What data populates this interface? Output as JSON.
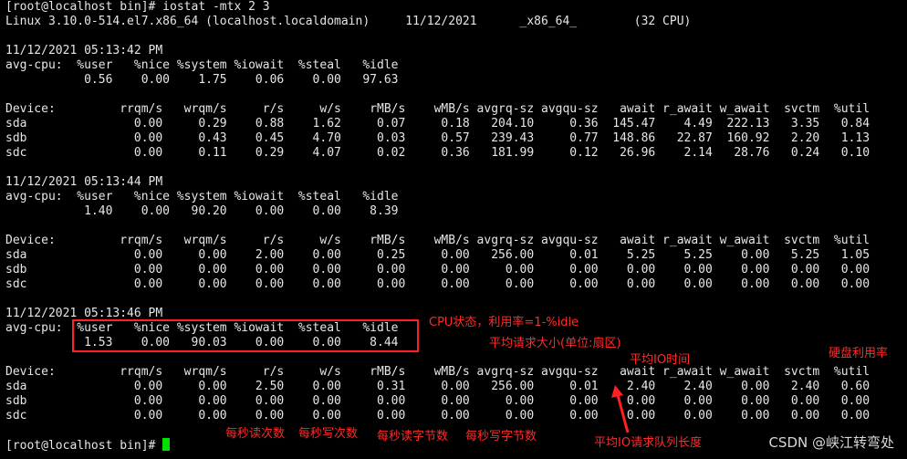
{
  "terminal": {
    "colors": {
      "background": "#000000",
      "text": "#e6e6e6",
      "cursor": "#00e000",
      "annotation": "#ff2a2a"
    },
    "lines": [
      "[root@localhost bin]# iostat -mtx 2 3",
      "Linux 3.10.0-514.el7.x86_64 (localhost.localdomain)     11/12/2021      _x86_64_        (32 CPU)",
      "",
      "11/12/2021 05:13:42 PM",
      "avg-cpu:  %user   %nice %system %iowait  %steal   %idle",
      "           0.56    0.00    1.75    0.06    0.00   97.63",
      "",
      "Device:         rrqm/s   wrqm/s     r/s     w/s    rMB/s    wMB/s avgrq-sz avgqu-sz   await r_await w_await  svctm  %util",
      "sda               0.00     0.29    0.88    1.62     0.07     0.18   204.10     0.36  145.47    4.49  222.13   3.35   0.84",
      "sdb               0.00     0.43    0.45    4.70     0.03     0.57   239.43     0.77  148.86   22.87  160.92   2.20   1.13",
      "sdc               0.00     0.11    0.29    4.07     0.02     0.36   181.99     0.12   26.96    2.14   28.76   0.24   0.10",
      "",
      "11/12/2021 05:13:44 PM",
      "avg-cpu:  %user   %nice %system %iowait  %steal   %idle",
      "           1.40    0.00   90.20    0.00    0.00    8.39",
      "",
      "Device:         rrqm/s   wrqm/s     r/s     w/s    rMB/s    wMB/s avgrq-sz avgqu-sz   await r_await w_await  svctm  %util",
      "sda               0.00     0.00    2.00    0.00     0.25     0.00   256.00     0.01    5.25    5.25    0.00   5.25   1.05",
      "sdb               0.00     0.00    0.00    0.00     0.00     0.00     0.00     0.00    0.00    0.00    0.00   0.00   0.00",
      "sdc               0.00     0.00    0.00    0.00     0.00     0.00     0.00     0.00    0.00    0.00    0.00   0.00   0.00",
      "",
      "11/12/2021 05:13:46 PM",
      "avg-cpu:  %user   %nice %system %iowait  %steal   %idle",
      "           1.53    0.00   90.03    0.00    0.00    8.44",
      "",
      "Device:         rrqm/s   wrqm/s     r/s     w/s    rMB/s    wMB/s avgrq-sz avgqu-sz   await r_await w_await  svctm  %util",
      "sda               0.00     0.00    2.50    0.00     0.31     0.00   256.00     0.01    2.40    2.40    0.00   2.40   0.60",
      "sdb               0.00     0.00    0.00    0.00     0.00     0.00     0.00     0.00    0.00    0.00    0.00   0.00   0.00",
      "sdc               0.00     0.00    0.00    0.00     0.00     0.00     0.00     0.00    0.00    0.00    0.00   0.00   0.00",
      "",
      "[root@localhost bin]# "
    ]
  },
  "annotations": {
    "cpu_state": "CPU状态，利用率=1-%idle",
    "avg_request_size": "平均请求大小(单位:扇区)",
    "avg_io_time": "平均IO时间",
    "disk_util": "硬盘利用率",
    "reads_per_sec": "每秒读次数",
    "writes_per_sec": "每秒写次数",
    "read_bytes_per_sec": "每秒读字节数",
    "write_bytes_per_sec": "每秒写字节数",
    "avg_queue_length": "平均IO请求队列长度"
  },
  "watermark": "CSDN @峡江转弯处"
}
